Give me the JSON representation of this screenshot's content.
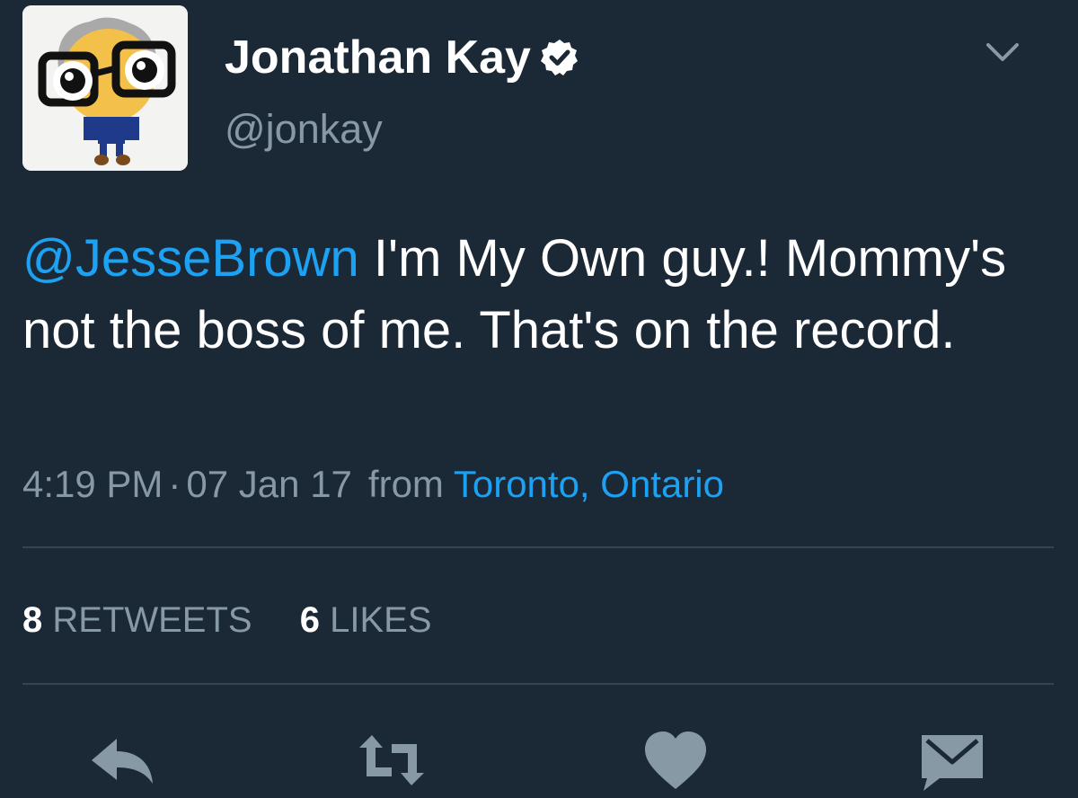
{
  "profile": {
    "display_name": "Jonathan Kay",
    "handle": "@jonkay",
    "verified_icon": "verified-badge-icon",
    "avatar": "cartoon-avatar"
  },
  "tweet": {
    "mention": "@JesseBrown",
    "text_after_mention": " I'm My Own guy.! Mommy's not the boss of me. That's on the record.",
    "time": "4:19 PM",
    "separator": "·",
    "date": "07 Jan 17",
    "from_label": "from",
    "location": "Toronto, Ontario"
  },
  "stats": {
    "retweets_count": "8",
    "retweets_label": "RETWEETS",
    "likes_count": "6",
    "likes_label": "LIKES"
  },
  "actions": [
    {
      "name": "reply",
      "icon": "reply-icon"
    },
    {
      "name": "retweet",
      "icon": "retweet-icon"
    },
    {
      "name": "like",
      "icon": "heart-icon"
    },
    {
      "name": "direct-message",
      "icon": "envelope-icon"
    }
  ],
  "colors": {
    "background": "#1b2836",
    "text": "#ffffff",
    "secondary": "#8899a6",
    "link": "#1da1f2",
    "divider": "#38444d",
    "icons": "#8899a6"
  }
}
